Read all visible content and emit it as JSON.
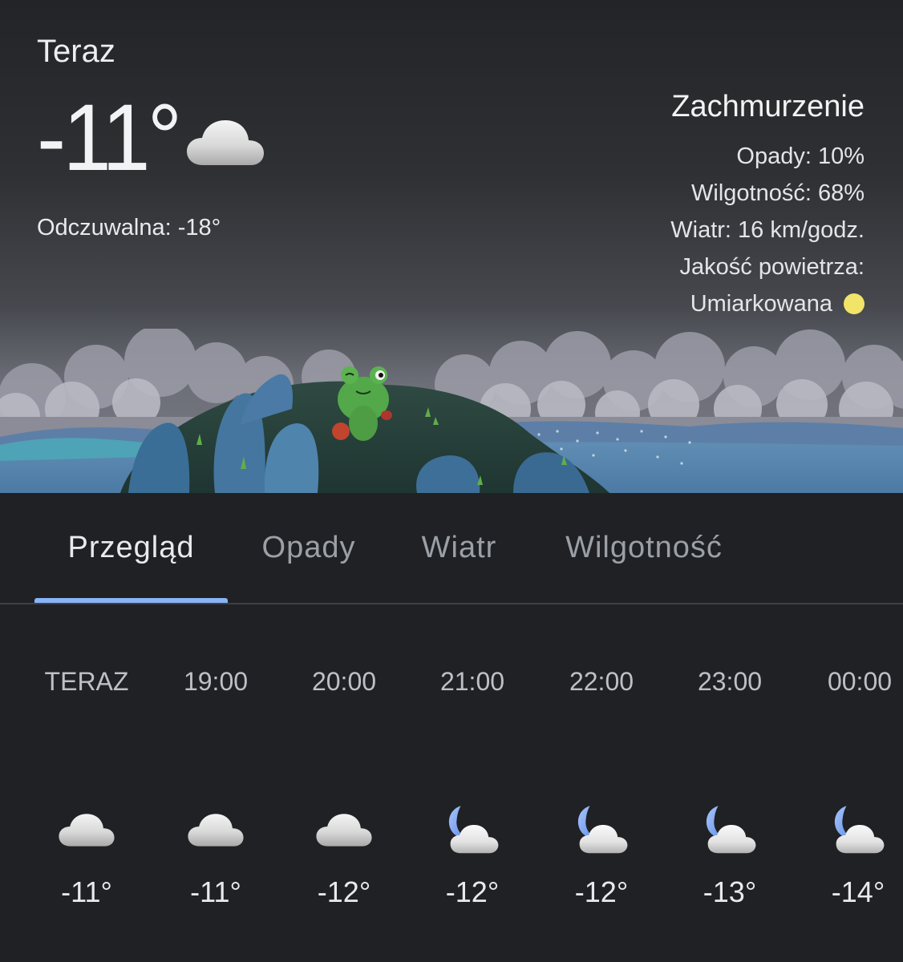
{
  "current": {
    "label": "Teraz",
    "temperature": "-11°",
    "icon": "cloud-icon",
    "feels_like": "Odczuwalna: -18°"
  },
  "details": {
    "condition": "Zachmurzenie",
    "precipitation": "Opady: 10%",
    "humidity": "Wilgotność: 68%",
    "wind": "Wiatr: 16 km/godz.",
    "air_quality_label": "Jakość powietrza:",
    "air_quality_value": "Umiarkowana",
    "air_quality_color": "#f1e469"
  },
  "tabs": [
    {
      "label": "Przegląd",
      "active": true
    },
    {
      "label": "Opady",
      "active": false
    },
    {
      "label": "Wiatr",
      "active": false
    },
    {
      "label": "Wilgotność",
      "active": false
    }
  ],
  "colors": {
    "background": "#202124",
    "accent": "#8ab4f8",
    "moon": "#8ab4f8"
  },
  "hourly": [
    {
      "time": "TERAZ",
      "icon": "cloud-icon",
      "temp": "-11°"
    },
    {
      "time": "19:00",
      "icon": "cloud-icon",
      "temp": "-11°"
    },
    {
      "time": "20:00",
      "icon": "cloud-icon",
      "temp": "-12°"
    },
    {
      "time": "21:00",
      "icon": "moon-cloud-icon",
      "temp": "-12°"
    },
    {
      "time": "22:00",
      "icon": "moon-cloud-icon",
      "temp": "-12°"
    },
    {
      "time": "23:00",
      "icon": "moon-cloud-icon",
      "temp": "-13°"
    },
    {
      "time": "00:00",
      "icon": "moon-cloud-icon",
      "temp": "-14°"
    }
  ]
}
